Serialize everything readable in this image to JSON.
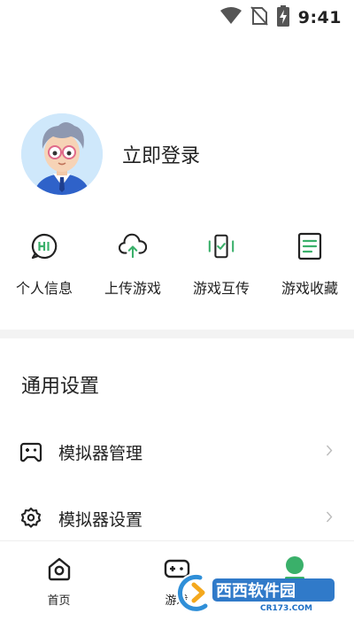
{
  "status_bar": {
    "time": "9:41",
    "icons": [
      "wifi-icon",
      "no-sim-icon",
      "battery-charging-icon"
    ]
  },
  "profile": {
    "login_label": "立即登录",
    "avatar_icon": "user-avatar-illustration"
  },
  "features": [
    {
      "label": "个人信息",
      "icon": "hi-chat-bubble-icon"
    },
    {
      "label": "上传游戏",
      "icon": "cloud-upload-icon"
    },
    {
      "label": "游戏互传",
      "icon": "phone-transfer-icon"
    },
    {
      "label": "游戏收藏",
      "icon": "document-list-icon"
    }
  ],
  "settings": {
    "title": "通用设置",
    "items": [
      {
        "label": "模拟器管理",
        "icon": "gamepad-icon"
      },
      {
        "label": "模拟器设置",
        "icon": "gear-icon"
      }
    ]
  },
  "tabbar": {
    "tabs": [
      {
        "label": "首页",
        "icon": "home-icon"
      },
      {
        "label": "游戏",
        "icon": "gamepad-tab-icon"
      },
      {
        "label": "",
        "icon": "profile-tab-icon"
      }
    ]
  },
  "watermark": {
    "text": "西西软件园",
    "url_text": "CR173.COM"
  },
  "colors": {
    "accent_green": "#3ab06a",
    "text": "#222222",
    "divider": "#f3f3f3",
    "chevron": "#bbbbbb"
  }
}
